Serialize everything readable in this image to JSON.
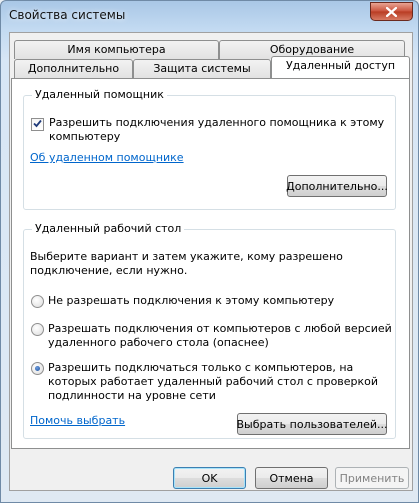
{
  "window": {
    "title": "Свойства системы"
  },
  "tabs": {
    "row1": [
      "Имя компьютера",
      "Оборудование"
    ],
    "row2": [
      "Дополнительно",
      "Защита системы",
      "Удаленный доступ"
    ]
  },
  "remote_assistance": {
    "group_title": "Удаленный помощник",
    "checkbox_label_line1": "Разрешить подключения удаленного помощника к этому",
    "checkbox_label_line2": "компьютеру",
    "checkbox_checked": true,
    "link": "Об удаленном помощнике",
    "advanced_button": "Дополнительно..."
  },
  "remote_desktop": {
    "group_title": "Удаленный рабочий стол",
    "description_line1": "Выберите вариант и затем укажите, кому разрешено",
    "description_line2": "подключение, если нужно.",
    "options": [
      {
        "lines": [
          "Не разрешать подключения к этому компьютеру"
        ],
        "selected": false
      },
      {
        "lines": [
          "Разрешать подключения от компьютеров с любой версией",
          "удаленного рабочего стола (опаснее)"
        ],
        "selected": false
      },
      {
        "lines": [
          "Разрешить подключаться только с компьютеров, на",
          "которых работает удаленный рабочий стол с проверкой",
          "подлинности на уровне сети"
        ],
        "selected": true
      }
    ],
    "help_link": "Помочь выбрать",
    "select_users_button": "Выбрать пользователей..."
  },
  "footer": {
    "ok": "OK",
    "cancel": "Отмена",
    "apply": "Применить"
  },
  "colors": {
    "link": "#0066cc",
    "title_gradient_top": "#a9c7e6",
    "close_button": "#c9503a",
    "radio_dot": "#1c4f9a"
  },
  "icons": {
    "close": "close-icon",
    "check": "check-icon"
  }
}
